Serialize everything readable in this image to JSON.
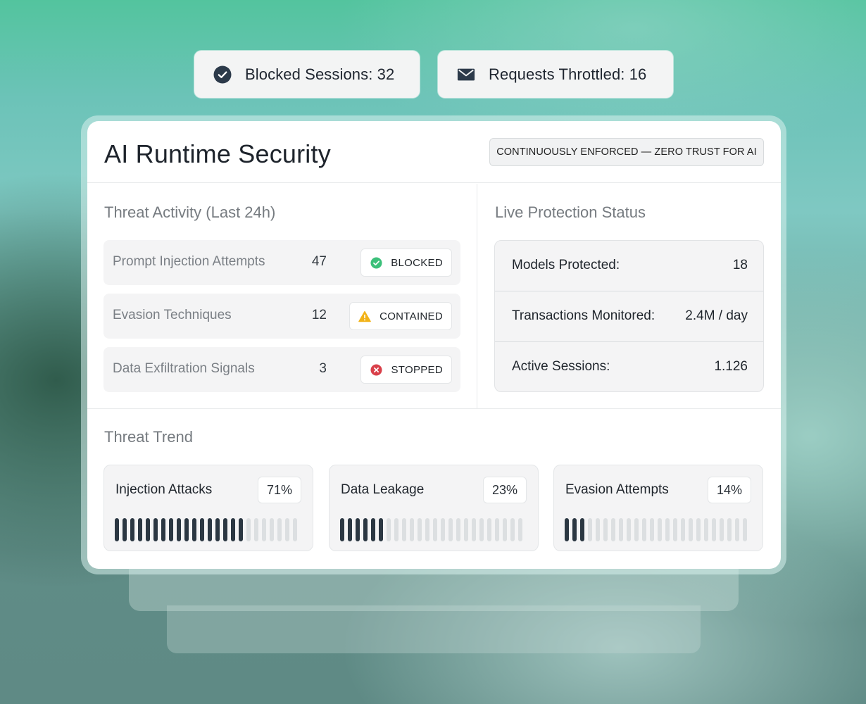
{
  "top_stats": {
    "blocked": {
      "label": "Blocked Sessions: 32",
      "icon": "check-circle-icon"
    },
    "throttled": {
      "label": "Requests Throttled: 16",
      "icon": "envelope-icon"
    }
  },
  "card": {
    "title": "AI Runtime Security",
    "badge": "CONTINUOUSLY ENFORCED — ZERO TRUST FOR AI"
  },
  "threat_activity": {
    "title": "Threat Activity (Last 24h)",
    "rows": [
      {
        "label": "Prompt Injection Attempts",
        "count": "47",
        "status": "BLOCKED",
        "status_icon": "check-circle-icon",
        "status_color": "#3cc07a"
      },
      {
        "label": "Evasion Techniques",
        "count": "12",
        "status": "CONTAINED",
        "status_icon": "warning-icon",
        "status_color": "#f2b318"
      },
      {
        "label": "Data Exfiltration Signals",
        "count": "3",
        "status": "STOPPED",
        "status_icon": "x-circle-icon",
        "status_color": "#d9404a"
      }
    ]
  },
  "live_protection": {
    "title": "Live Protection Status",
    "rows": [
      {
        "label": "Models Protected:",
        "value": "18"
      },
      {
        "label": "Transactions Monitored:",
        "value": "2.4M / day"
      },
      {
        "label": "Active Sessions:",
        "value": "1.126"
      }
    ]
  },
  "threat_trend": {
    "title": "Threat Trend",
    "items": [
      {
        "label": "Injection Attacks",
        "percent": "71%",
        "fraction": 0.71
      },
      {
        "label": "Data Leakage",
        "percent": "23%",
        "fraction": 0.23
      },
      {
        "label": "Evasion Attempts",
        "percent": "14%",
        "fraction": 0.14
      }
    ],
    "bar_color": "#2b3742",
    "bar_bg_color": "#dcdfe1"
  }
}
